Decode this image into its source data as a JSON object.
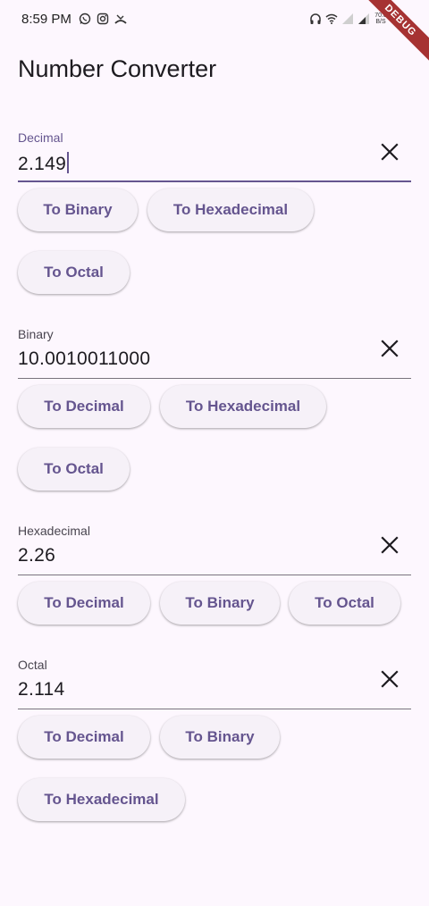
{
  "status_bar": {
    "time": "8:59 PM",
    "left_icons": [
      "whatsapp-icon",
      "instagram-icon",
      "missed-call-icon"
    ],
    "right_icons": [
      "headphones-icon",
      "wifi-icon",
      "signal-weak-icon",
      "signal-icon"
    ],
    "net_speed_top": "70.0",
    "net_speed_bottom": "B/S",
    "battery_icon": "battery-icon"
  },
  "debug_banner": "DEBUG",
  "app": {
    "title": "Number Converter"
  },
  "fields": {
    "decimal": {
      "label": "Decimal",
      "value": "2.149",
      "buttons": [
        "To Binary",
        "To Hexadecimal",
        "To Octal"
      ]
    },
    "binary": {
      "label": "Binary",
      "value": "10.0010011000",
      "buttons": [
        "To Decimal",
        "To Hexadecimal",
        "To Octal"
      ]
    },
    "hexadecimal": {
      "label": "Hexadecimal",
      "value": "2.26",
      "buttons": [
        "To Decimal",
        "To Binary",
        "To Octal"
      ]
    },
    "octal": {
      "label": "Octal",
      "value": "2.114",
      "buttons": [
        "To Decimal",
        "To Binary",
        "To Hexadecimal"
      ]
    }
  },
  "colors": {
    "background": "#fdf7fe",
    "accent": "#65558f",
    "button_bg": "#f6f1f8",
    "debug": "#a63232"
  }
}
